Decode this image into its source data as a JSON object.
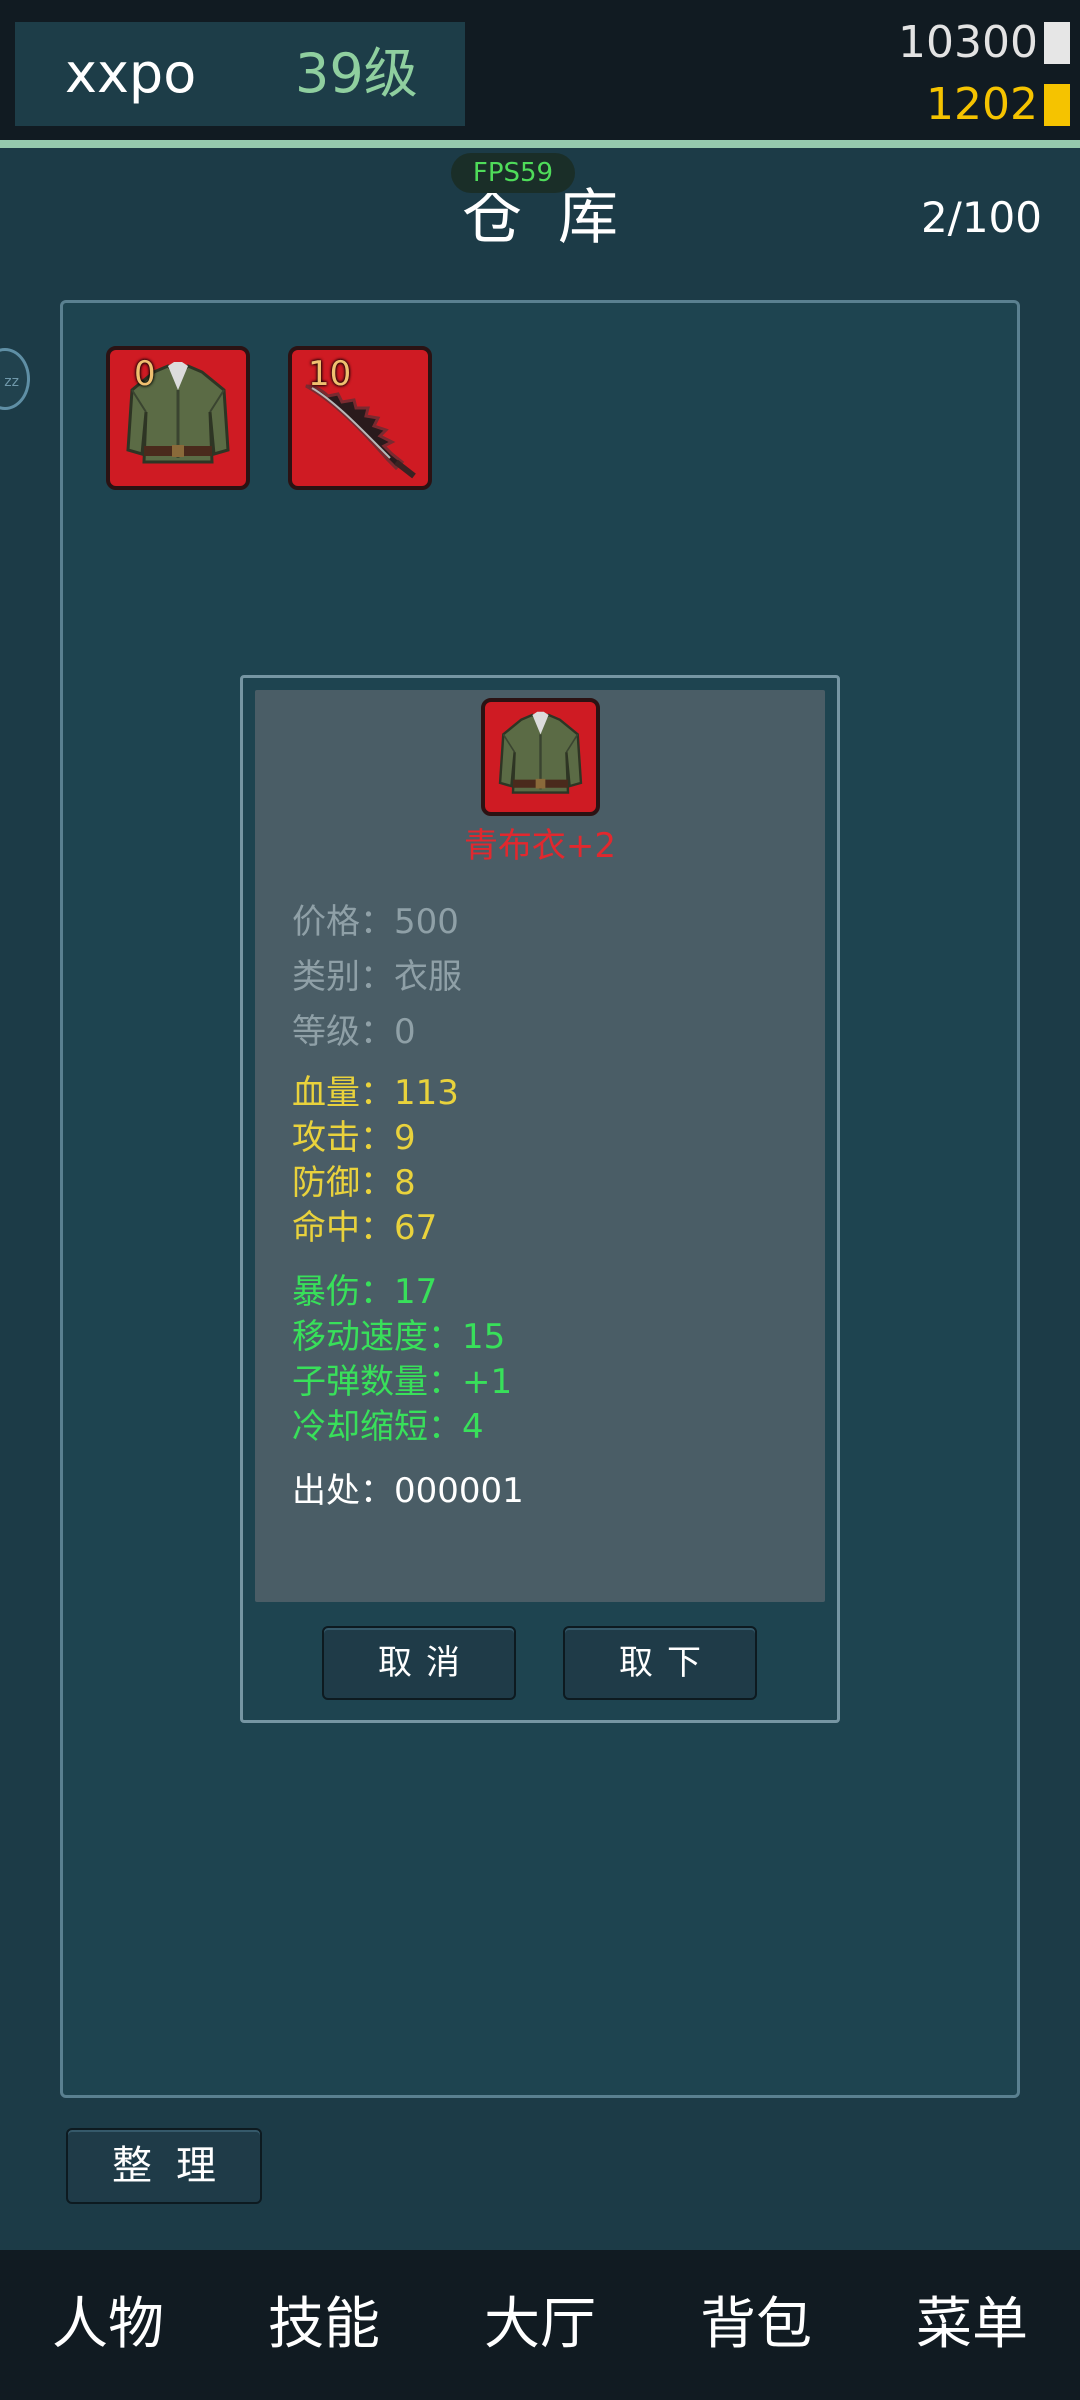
{
  "player": {
    "name": "xxpo",
    "level": "39级"
  },
  "currency": {
    "silver": "10300",
    "gold": "1202"
  },
  "header": {
    "fps": "FPS59",
    "title": "仓库",
    "capacity": "2/100"
  },
  "side_button": {
    "label": "zz"
  },
  "warehouse": {
    "slots": [
      {
        "count": "0",
        "icon": "tunic-icon"
      },
      {
        "count": "10",
        "icon": "blade-icon"
      }
    ]
  },
  "detail": {
    "icon": "tunic-icon",
    "name": "青布衣+2",
    "rows": [
      {
        "label": "价格：",
        "value": "500",
        "color": "gray"
      },
      {
        "label": "类别：",
        "value": "衣服",
        "color": "gray"
      },
      {
        "label": "等级：",
        "value": "0",
        "color": "gray"
      },
      {
        "label": "血量：",
        "value": "113",
        "color": "yellow"
      },
      {
        "label": "攻击：",
        "value": "9",
        "color": "yellow"
      },
      {
        "label": "防御：",
        "value": "8",
        "color": "yellow"
      },
      {
        "label": "命中：",
        "value": "67",
        "color": "yellow"
      },
      {
        "label": "暴伤：",
        "value": "17",
        "color": "green"
      },
      {
        "label": "移动速度：",
        "value": "15",
        "color": "green"
      },
      {
        "label": "子弹数量：",
        "value": "+1",
        "color": "green"
      },
      {
        "label": "冷却缩短：",
        "value": "4",
        "color": "green"
      },
      {
        "label": "出处：",
        "value": "000001",
        "color": "white"
      }
    ],
    "buttons": {
      "cancel": "取消",
      "remove": "取下"
    }
  },
  "sort_button": "整理",
  "nav": [
    "人物",
    "技能",
    "大厅",
    "背包",
    "菜单"
  ],
  "colors": {
    "background": "#1c3b47",
    "slot_red": "#cf1b23",
    "item_name_red": "#e2282e",
    "stat_yellow": "#e9d23c",
    "stat_green": "#38e05a",
    "gold": "#f5c300"
  }
}
